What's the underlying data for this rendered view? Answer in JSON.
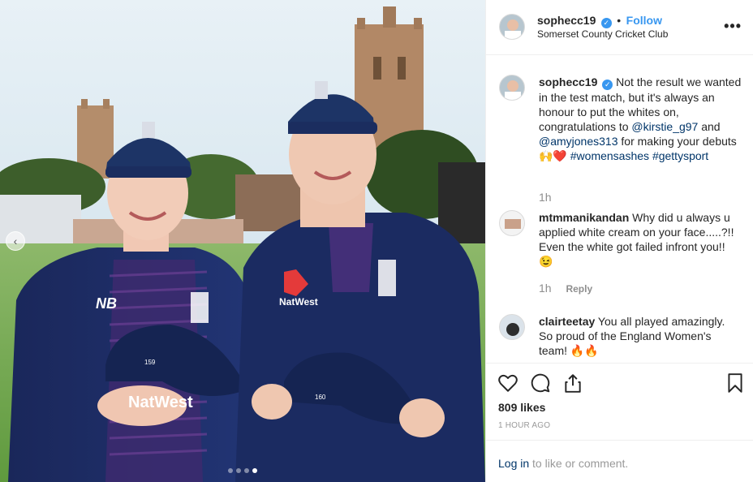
{
  "post": {
    "username": "sophecc19",
    "verified_mark": "✓",
    "follow_separator": "•",
    "follow_label": "Follow",
    "location": "Somerset County Cricket Club",
    "more_icon": "•••",
    "photo_caption_prev": "‹",
    "carousel_dots": 4,
    "carousel_active": 3
  },
  "caption": {
    "username": "sophecc19",
    "text_before": "Not the result we wanted in the test match, but it's always an honour to put the whites on, congratulations to",
    "mention1": "@kirstie_g97",
    "and": "and",
    "mention2": "@amyjones313",
    "text_after": "for making your debuts",
    "emoji": "🙌❤️",
    "hashtag1": "#womensashes",
    "hashtag2": "#gettysport",
    "time": "1h"
  },
  "comments": [
    {
      "username": "mtmmanikandan",
      "text": "Why did u always u applied white cream on your face.....?!! Even the white got failed infront you!!",
      "emoji": "😉",
      "time": "1h",
      "reply_label": "Reply"
    },
    {
      "username": "clairteetay",
      "text": "You all played amazingly. So proud of the England Women's team!",
      "emoji": "🔥🔥"
    }
  ],
  "actions": {
    "like_icon": "heart-icon",
    "comment_icon": "comment-bubble-icon",
    "share_icon": "share-icon",
    "save_icon": "bookmark-icon",
    "likes_text": "809 likes",
    "timestamp": "1 HOUR AGO"
  },
  "footer": {
    "login_link": "Log in",
    "login_rest": "to like or comment."
  },
  "photo": {
    "sponsor_left": "NatWest",
    "sponsor_right": "NatWest",
    "cap_number_left": "159",
    "cap_number_right": "160",
    "shirt_logo": "NB"
  },
  "colors": {
    "accent_blue": "#3897f0",
    "link_blue": "#003569",
    "navy_kit": "#1b2a5e",
    "muted": "#8e8e8e"
  }
}
